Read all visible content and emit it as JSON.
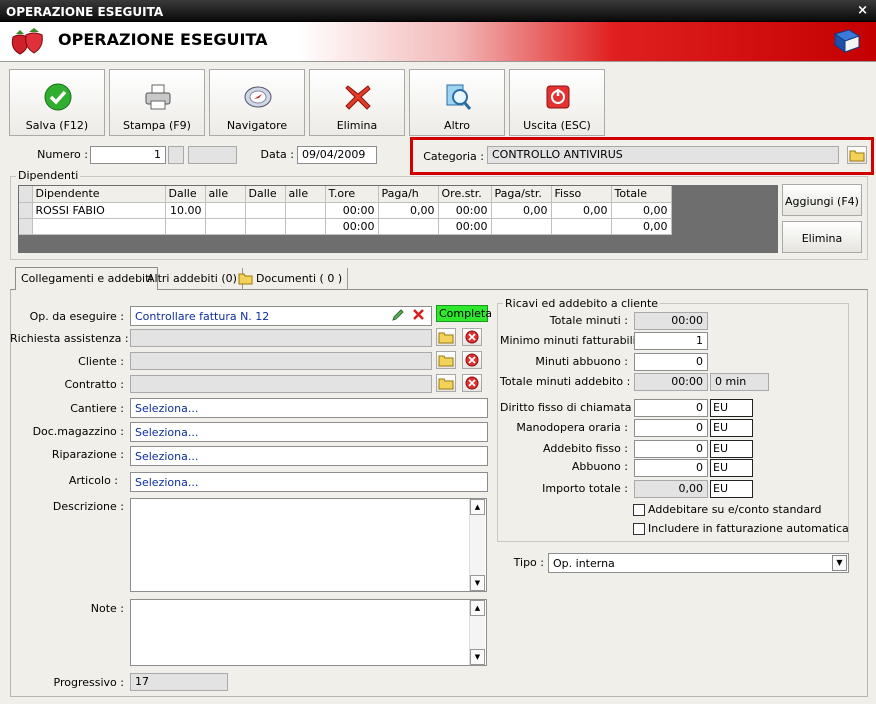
{
  "window": {
    "title": "OPERAZIONE ESEGUITA",
    "close": "×"
  },
  "header": {
    "title": "OPERAZIONE ESEGUITA"
  },
  "toolbar": [
    {
      "label": "Salva (F12)",
      "icon": "check-icon"
    },
    {
      "label": "Stampa (F9)",
      "icon": "printer-icon"
    },
    {
      "label": "Navigatore",
      "icon": "compass-icon"
    },
    {
      "label": "Elimina",
      "icon": "delete-x-icon"
    },
    {
      "label": "Altro",
      "icon": "magnifier-icon"
    },
    {
      "label": "Uscita (ESC)",
      "icon": "power-icon"
    }
  ],
  "top": {
    "numero_label": "Numero :",
    "numero_value": "1",
    "data_label": "Data :",
    "data_value": "09/04/2009",
    "categoria_label": "Categoria :",
    "categoria_value": "CONTROLLO ANTIVIRUS"
  },
  "dipendenti": {
    "title": "Dipendenti",
    "columns": [
      "Dipendente",
      "Dalle",
      "alle",
      "Dalle",
      "alle",
      "T.ore",
      "Paga/h",
      "Ore.str.",
      "Paga/str.",
      "Fisso",
      "Totale"
    ],
    "rows": [
      [
        "ROSSI FABIO",
        "10.00",
        "",
        "",
        "",
        "00:00",
        "0,00",
        "00:00",
        "0,00",
        "0,00",
        "0,00"
      ],
      [
        "",
        "",
        "",
        "",
        "",
        "00:00",
        "",
        "00:00",
        "",
        "",
        "0,00"
      ]
    ],
    "add_button": "Aggiungi (F4)",
    "delete_button": "Elimina"
  },
  "tabs": [
    "Collegamenti e addebiti",
    "Altri addebiti (0)",
    "Documenti ( 0 )"
  ],
  "left": {
    "op_label": "Op. da eseguire :",
    "op_value": "Controllare fattura N. 12",
    "status": "Completa",
    "richiesta_label": "Richiesta assistenza :",
    "cliente_label": "Cliente :",
    "contratto_label": "Contratto :",
    "cantiere_label": "Cantiere :",
    "cantiere_value": "Seleziona...",
    "docmag_label": "Doc.magazzino :",
    "docmag_value": "Seleziona...",
    "riparazione_label": "Riparazione :",
    "riparazione_value": "Seleziona...",
    "articolo_label": "Articolo :",
    "articolo_value": "Seleziona...",
    "descrizione_label": "Descrizione :",
    "note_label": "Note :",
    "progressivo_label": "Progressivo :",
    "progressivo_value": "17"
  },
  "ricavi": {
    "title": "Ricavi ed addebito a cliente",
    "totale_minuti_label": "Totale minuti :",
    "totale_minuti_value": "00:00",
    "minimo_label": "Minimo minuti fatturabili :",
    "minimo_value": "1",
    "abbuono_min_label": "Minuti abbuono :",
    "abbuono_min_value": "0",
    "tot_addebito_label": "Totale minuti addebito :",
    "tot_addebito_value": "00:00",
    "tot_addebito_min": "0 min",
    "diritto_label": "Diritto fisso di chiamata :",
    "diritto_value": "0",
    "diritto_cur": "EU",
    "manodopera_label": "Manodopera oraria :",
    "manodopera_value": "0",
    "manodopera_cur": "EU",
    "addebito_label": "Addebito fisso :",
    "addebito_value": "0",
    "addebito_cur": "EU",
    "abbuono_label": "Abbuono :",
    "abbuono_value": "0",
    "abbuono_cur": "EU",
    "importo_label": "Importo totale :",
    "importo_value": "0,00",
    "importo_cur": "EU",
    "chk1": "Addebitare su e/conto standard",
    "chk2": "Includere in fatturazione automatica"
  },
  "tipo": {
    "label": "Tipo :",
    "value": "Op. interna"
  }
}
